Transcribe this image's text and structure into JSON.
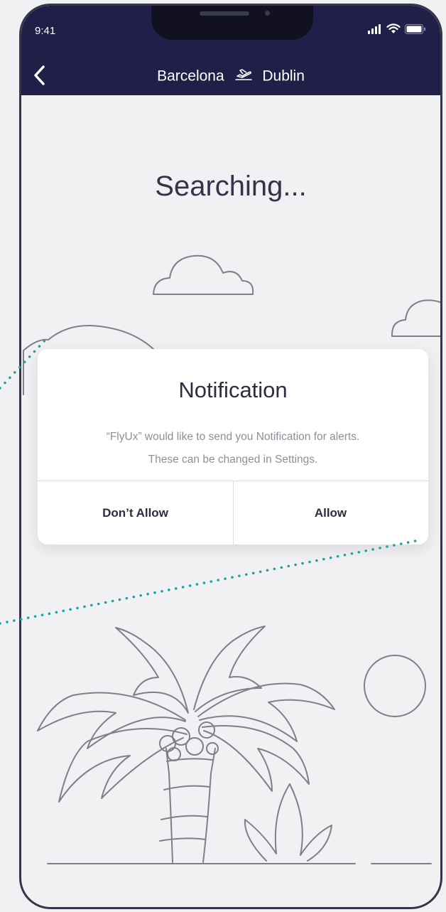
{
  "status_bar": {
    "time": "9:41",
    "icons": [
      "signal-icon",
      "wifi-icon",
      "battery-icon"
    ]
  },
  "header": {
    "from_city": "Barcelona",
    "to_city": "Dublin",
    "back_icon": "chevron-left-icon",
    "route_icon": "plane-icon"
  },
  "main": {
    "title": "Searching..."
  },
  "dialog": {
    "title": "Notification",
    "message_line1": "“FlyUx” would like to send you Notification for alerts.",
    "message_line2": "These can be changed in Settings.",
    "deny_label": "Don’t Allow",
    "allow_label": "Allow"
  },
  "colors": {
    "header_bg": "#1f1f47",
    "screen_bg": "#f1f1f3",
    "illustration_stroke": "#7e7f89",
    "annotation_dots": "#1aa3a3"
  }
}
